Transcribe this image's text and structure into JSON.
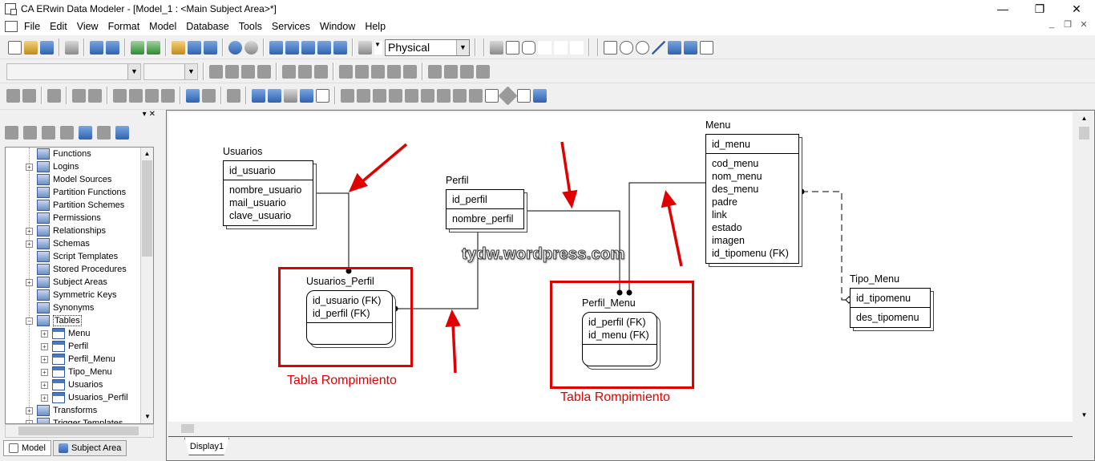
{
  "window": {
    "title": "CA ERwin Data Modeler - [Model_1 : <Main Subject Area>*]",
    "min": "—",
    "max": "❐",
    "close": "✕"
  },
  "menu": [
    "File",
    "Edit",
    "View",
    "Format",
    "Model",
    "Database",
    "Tools",
    "Services",
    "Window",
    "Help"
  ],
  "toolbar": {
    "view_mode": "Physical",
    "mdi_min": "_",
    "mdi_restore": "❐",
    "mdi_close": "✕"
  },
  "tree": {
    "items": [
      {
        "label": "Functions",
        "icon": "function-icon",
        "expander": "",
        "level": 0
      },
      {
        "label": "Logins",
        "icon": "login-icon",
        "expander": "+",
        "level": 0
      },
      {
        "label": "Model Sources",
        "icon": "model-sources-icon",
        "expander": "",
        "level": 0
      },
      {
        "label": "Partition Functions",
        "icon": "partition-functions-icon",
        "expander": "",
        "level": 0
      },
      {
        "label": "Partition Schemes",
        "icon": "partition-schemes-icon",
        "expander": "",
        "level": 0
      },
      {
        "label": "Permissions",
        "icon": "permissions-icon",
        "expander": "",
        "level": 0
      },
      {
        "label": "Relationships",
        "icon": "relationships-icon",
        "expander": "+",
        "level": 0
      },
      {
        "label": "Schemas",
        "icon": "schemas-icon",
        "expander": "+",
        "level": 0
      },
      {
        "label": "Script Templates",
        "icon": "script-templates-icon",
        "expander": "",
        "level": 0
      },
      {
        "label": "Stored Procedures",
        "icon": "stored-procedures-icon",
        "expander": "",
        "level": 0
      },
      {
        "label": "Subject Areas",
        "icon": "subject-areas-icon",
        "expander": "+",
        "level": 0
      },
      {
        "label": "Symmetric Keys",
        "icon": "symmetric-keys-icon",
        "expander": "",
        "level": 0
      },
      {
        "label": "Synonyms",
        "icon": "synonyms-icon",
        "expander": "",
        "level": 0
      },
      {
        "label": "Tables",
        "icon": "tables-icon",
        "expander": "−",
        "level": 0
      },
      {
        "label": "Menu",
        "icon": "table-icon",
        "expander": "+",
        "level": 1
      },
      {
        "label": "Perfil",
        "icon": "table-icon",
        "expander": "+",
        "level": 1
      },
      {
        "label": "Perfil_Menu",
        "icon": "table-icon",
        "expander": "+",
        "level": 1
      },
      {
        "label": "Tipo_Menu",
        "icon": "table-icon",
        "expander": "+",
        "level": 1
      },
      {
        "label": "Usuarios",
        "icon": "table-icon",
        "expander": "+",
        "level": 1
      },
      {
        "label": "Usuarios_Perfil",
        "icon": "table-icon",
        "expander": "+",
        "level": 1
      },
      {
        "label": "Transforms",
        "icon": "transforms-icon",
        "expander": "+",
        "level": 0
      },
      {
        "label": "Trigger Templates",
        "icon": "trigger-templates-icon",
        "expander": "+",
        "level": 0
      }
    ]
  },
  "panel_tabs": {
    "model": "Model",
    "subject_area": "Subject Area"
  },
  "diagram": {
    "entities": {
      "usuarios": {
        "name": "Usuarios",
        "pk": [
          "id_usuario"
        ],
        "attrs": [
          "nombre_usuario",
          "mail_usuario",
          "clave_usuario"
        ]
      },
      "perfil": {
        "name": "Perfil",
        "pk": [
          "id_perfil"
        ],
        "attrs": [
          "nombre_perfil"
        ]
      },
      "menu": {
        "name": "Menu",
        "pk": [
          "id_menu"
        ],
        "attrs": [
          "cod_menu",
          "nom_menu",
          "des_menu",
          "padre",
          "link",
          "estado",
          "imagen",
          "id_tipomenu (FK)"
        ]
      },
      "usuarios_perfil": {
        "name": "Usuarios_Perfil",
        "pk": [
          "id_usuario (FK)",
          "id_perfil (FK)"
        ],
        "attrs": []
      },
      "perfil_menu": {
        "name": "Perfil_Menu",
        "pk": [
          "id_perfil (FK)",
          "id_menu (FK)"
        ],
        "attrs": []
      },
      "tipo_menu": {
        "name": "Tipo_Menu",
        "pk": [
          "id_tipomenu"
        ],
        "attrs": [
          "des_tipomenu"
        ]
      }
    },
    "annotations": {
      "label1": "Tabla Rompimiento",
      "label2": "Tabla Rompimiento",
      "watermark": "tydw.wordpress.com"
    },
    "colors": {
      "annotation": "#e00000",
      "line": "#000000"
    }
  },
  "canvas_tab": "Display1"
}
